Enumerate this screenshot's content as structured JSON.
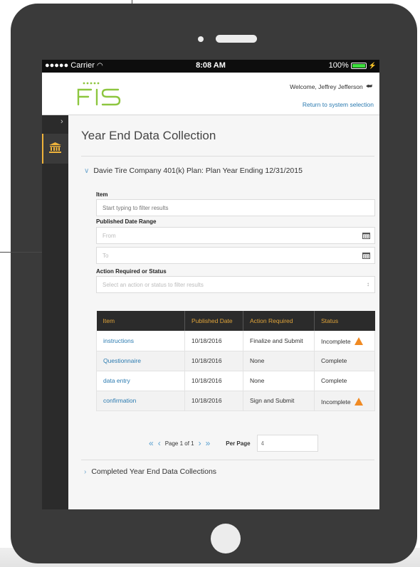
{
  "status_bar": {
    "carrier": "●●●●● Carrier",
    "time": "8:08 AM",
    "battery": "100%",
    "battery_level": 1.0
  },
  "header": {
    "logo_text": "FIS",
    "welcome": "Welcome, Jeffrey Jefferson",
    "return_link": "Return to system selection"
  },
  "page": {
    "title": "Year End Data Collection"
  },
  "accordion": {
    "open_title": "Davie Tire Company 401(k) Plan: Plan Year Ending 12/31/2015",
    "closed_title": "Completed Year End Data Collections"
  },
  "filters": {
    "item_label": "Item",
    "item_placeholder": "Start typing to filter results",
    "date_label": "Published Date Range",
    "from_placeholder": "From",
    "to_placeholder": "To",
    "action_label": "Action Required or Status",
    "action_placeholder": "Select an action or status to filter results"
  },
  "table": {
    "headers": [
      "Item",
      "Published Date",
      "Action Required",
      "Status"
    ],
    "rows": [
      {
        "item": "instructions",
        "date": "10/18/2016",
        "action": "Finalize and Submit",
        "status": "Incomplete",
        "warning": true
      },
      {
        "item": "Questionnaire",
        "date": "10/18/2016",
        "action": "None",
        "status": "Complete",
        "warning": false
      },
      {
        "item": "data entry",
        "date": "10/18/2016",
        "action": "None",
        "status": "Complete",
        "warning": false
      },
      {
        "item": "confirmation",
        "date": "10/18/2016",
        "action": "Sign and Submit",
        "status": "Incomplete",
        "warning": true
      }
    ]
  },
  "pagination": {
    "page_text": "Page 1 of 1",
    "per_page_label": "Per Page",
    "per_page_value": "4"
  },
  "colors": {
    "accent": "#f0b43b",
    "link": "#2a7ab0",
    "logo": "#8dc63f",
    "warning": "#f08a23"
  }
}
